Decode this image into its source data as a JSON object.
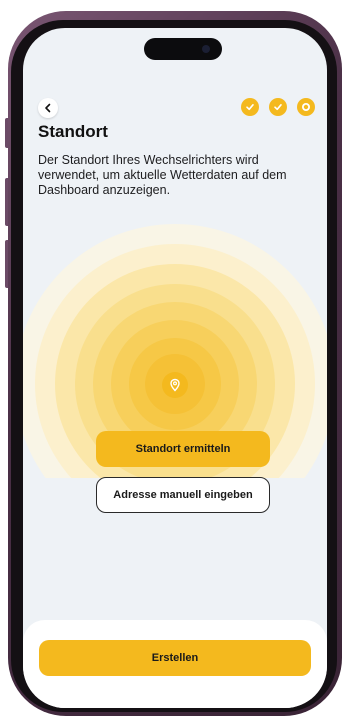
{
  "header": {
    "title": "Standort",
    "description": "Der Standort Ihres Wechselrichters wird verwendet, um aktuelle Wetterdaten auf dem Dashboard anzuzeigen."
  },
  "steps": {
    "total": 3,
    "completed": 2,
    "current": 3
  },
  "actions": {
    "locate_label": "Standort ermitteln",
    "manual_label": "Adresse manuell eingeben",
    "create_label": "Erstellen"
  },
  "icons": {
    "back": "chevron-left-icon",
    "step_done": "check-icon",
    "location": "map-pin-icon"
  },
  "colors": {
    "accent": "#f4b91e",
    "background": "#eef2f6",
    "text": "#111111"
  }
}
